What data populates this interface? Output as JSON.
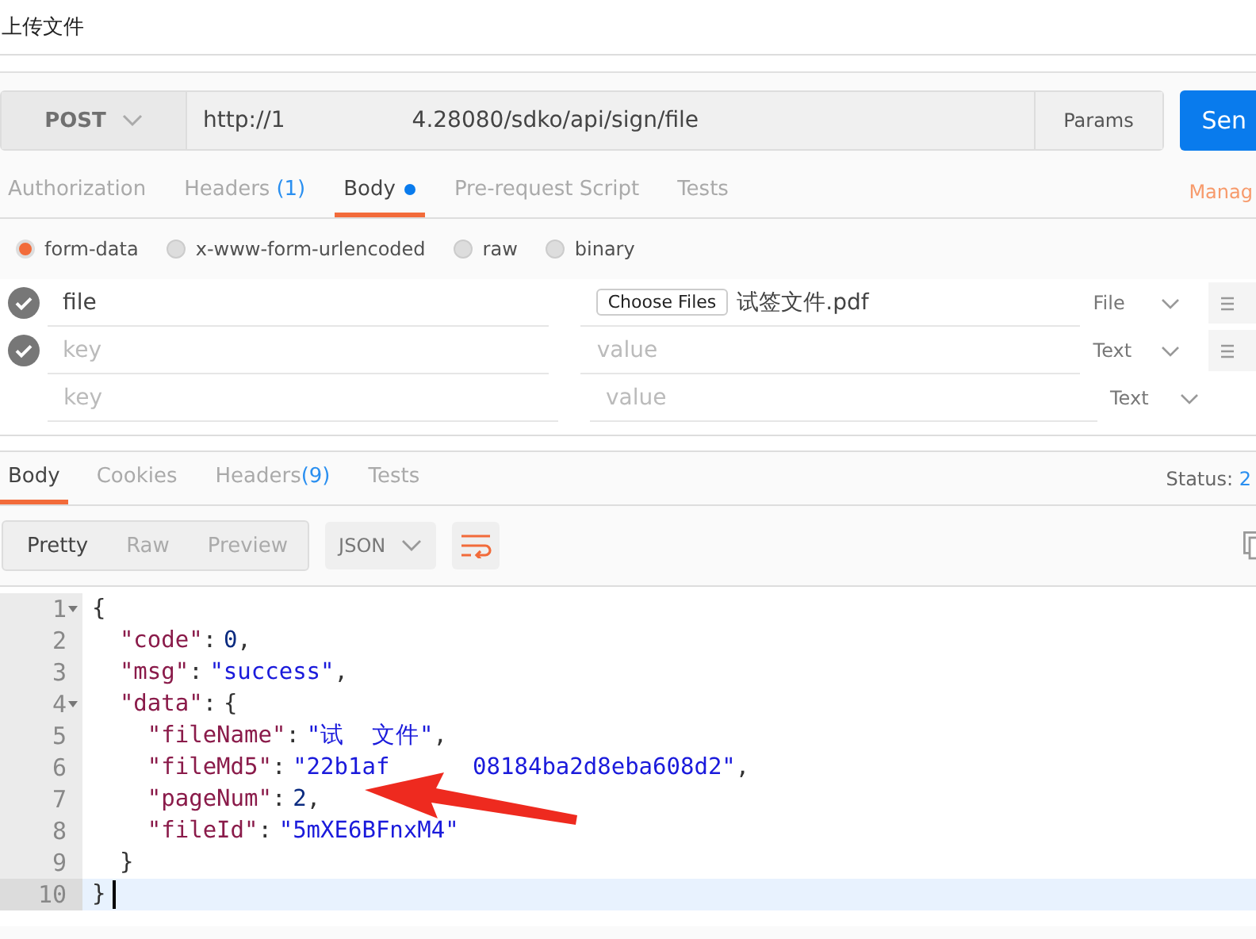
{
  "window": {
    "title": "上传文件"
  },
  "request": {
    "method": "POST",
    "url_start": "http://1",
    "url_end": "4.28080/sdko/api/sign/file",
    "params_button": "Params",
    "send_button": "Sen"
  },
  "request_tabs": [
    {
      "label": "Authorization",
      "selected": false,
      "dot": false
    },
    {
      "label": "Headers",
      "count": "(1)",
      "selected": false,
      "dot": false
    },
    {
      "label": "Body",
      "selected": true,
      "dot": true
    },
    {
      "label": "Pre-request Script",
      "selected": false,
      "dot": false
    },
    {
      "label": "Tests",
      "selected": false,
      "dot": false
    }
  ],
  "manage_link": "Manag",
  "body_modes": [
    {
      "label": "form-data",
      "selected": true
    },
    {
      "label": "x-www-form-urlencoded",
      "selected": false
    },
    {
      "label": "raw",
      "selected": false
    },
    {
      "label": "binary",
      "selected": false
    }
  ],
  "params": [
    {
      "checked": true,
      "key": "file",
      "kind": "file",
      "choose_button": "Choose Files",
      "file_name": "试签文件.pdf",
      "type": "File",
      "handle": true
    },
    {
      "checked": true,
      "key_placeholder": "key",
      "kind": "text",
      "value_placeholder": "value",
      "type": "Text",
      "handle": true
    },
    {
      "checked": false,
      "key_placeholder": "key",
      "kind": "text",
      "value_placeholder": "value",
      "type": "Text",
      "handle": false
    }
  ],
  "response_tabs": [
    {
      "label": "Body",
      "selected": true
    },
    {
      "label": "Cookies",
      "selected": false
    },
    {
      "label": "Headers",
      "count": "(9)",
      "selected": false
    },
    {
      "label": "Tests",
      "selected": false
    }
  ],
  "status": {
    "label": "Status:",
    "value": "2"
  },
  "view_modes": [
    {
      "label": "Pretty",
      "selected": true
    },
    {
      "label": "Raw",
      "selected": false
    },
    {
      "label": "Preview",
      "selected": false
    }
  ],
  "format": "JSON",
  "code_lines": [
    {
      "number": "1",
      "fold": true,
      "current": false,
      "tokens": [
        {
          "kind": "punct",
          "text": "{"
        }
      ]
    },
    {
      "number": "2",
      "fold": false,
      "current": false,
      "tokens": [
        {
          "kind": "indent"
        },
        {
          "kind": "key",
          "text": "\"code\""
        },
        {
          "kind": "punct",
          "text": ":"
        },
        {
          "kind": "number",
          "text": "0"
        },
        {
          "kind": "punct",
          "text": ","
        }
      ]
    },
    {
      "number": "3",
      "fold": false,
      "current": false,
      "tokens": [
        {
          "kind": "indent"
        },
        {
          "kind": "key",
          "text": "\"msg\""
        },
        {
          "kind": "punct",
          "text": ":"
        },
        {
          "kind": "string",
          "text": "\"success\""
        },
        {
          "kind": "punct",
          "text": ","
        }
      ]
    },
    {
      "number": "4",
      "fold": true,
      "current": false,
      "tokens": [
        {
          "kind": "indent"
        },
        {
          "kind": "key",
          "text": "\"data\""
        },
        {
          "kind": "punct",
          "text": ":"
        },
        {
          "kind": "punct",
          "text": "{"
        }
      ]
    },
    {
      "number": "5",
      "fold": false,
      "current": false,
      "tokens": [
        {
          "kind": "indent"
        },
        {
          "kind": "indent"
        },
        {
          "kind": "key",
          "text": "\"fileName\""
        },
        {
          "kind": "punct",
          "text": ":"
        },
        {
          "kind": "string",
          "text": "\"试"
        },
        {
          "kind": "redacted"
        },
        {
          "kind": "string",
          "text": "文件\""
        },
        {
          "kind": "punct",
          "text": ","
        }
      ]
    },
    {
      "number": "6",
      "fold": false,
      "current": false,
      "tokens": [
        {
          "kind": "indent"
        },
        {
          "kind": "indent"
        },
        {
          "kind": "key",
          "text": "\"fileMd5\""
        },
        {
          "kind": "punct",
          "text": ":"
        },
        {
          "kind": "string",
          "text": "\"22b1af"
        },
        {
          "kind": "redacted"
        },
        {
          "kind": "redacted"
        },
        {
          "kind": "redacted"
        },
        {
          "kind": "string",
          "text": "08184ba2d8eba608d2\""
        },
        {
          "kind": "punct",
          "text": ","
        }
      ]
    },
    {
      "number": "7",
      "fold": false,
      "current": false,
      "tokens": [
        {
          "kind": "indent"
        },
        {
          "kind": "indent"
        },
        {
          "kind": "key",
          "text": "\"pageNum\""
        },
        {
          "kind": "punct",
          "text": ":"
        },
        {
          "kind": "number",
          "text": "2"
        },
        {
          "kind": "punct",
          "text": ","
        }
      ]
    },
    {
      "number": "8",
      "fold": false,
      "current": false,
      "tokens": [
        {
          "kind": "indent"
        },
        {
          "kind": "indent"
        },
        {
          "kind": "key",
          "text": "\"fileId\""
        },
        {
          "kind": "punct",
          "text": ":"
        },
        {
          "kind": "string",
          "text": "\"5mXE6BFnxM4\""
        }
      ]
    },
    {
      "number": "9",
      "fold": false,
      "current": false,
      "tokens": [
        {
          "kind": "indent"
        },
        {
          "kind": "punct",
          "text": "}"
        }
      ]
    },
    {
      "number": "10",
      "fold": false,
      "current": true,
      "tokens": [
        {
          "kind": "punct",
          "text": "}"
        }
      ]
    }
  ]
}
